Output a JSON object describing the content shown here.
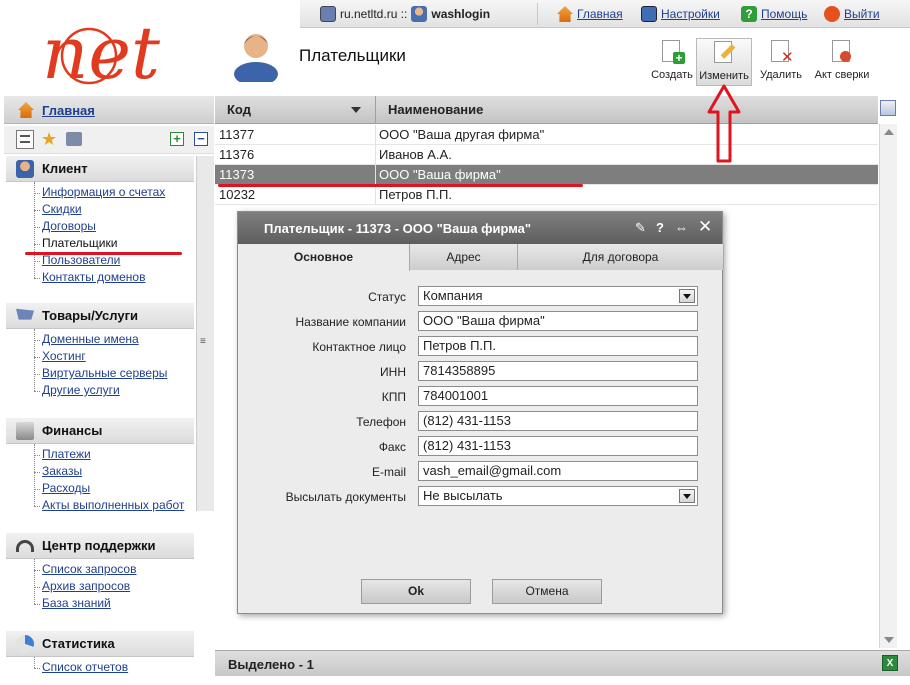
{
  "topbar": {
    "host_user": "ru.netltd.ru ::",
    "username": "washlogin",
    "home": "Главная",
    "settings": "Настройки",
    "help": "Помощь",
    "logout": "Выйти"
  },
  "logo_text": "net",
  "page": {
    "title": "Плательщики"
  },
  "toolbar": {
    "create": "Создать",
    "edit": "Изменить",
    "delete": "Удалить",
    "reconcile": "Акт сверки"
  },
  "sidebar": {
    "home": "Главная",
    "sections": [
      {
        "title": "Клиент",
        "items": [
          "Информация о счетах",
          "Скидки",
          "Договоры",
          "Плательщики",
          "Пользователи",
          "Контакты доменов"
        ]
      },
      {
        "title": "Товары/Услуги",
        "items": [
          "Доменные имена",
          "Хостинг",
          "Виртуальные серверы",
          "Другие услуги"
        ]
      },
      {
        "title": "Финансы",
        "items": [
          "Платежи",
          "Заказы",
          "Расходы",
          "Акты выполненных работ"
        ]
      },
      {
        "title": "Центр поддержки",
        "items": [
          "Список запросов",
          "Архив запросов",
          "База знаний"
        ]
      },
      {
        "title": "Статистика",
        "items": [
          "Список отчетов"
        ]
      }
    ]
  },
  "grid": {
    "col_code": "Код",
    "col_name": "Наименование",
    "rows": [
      {
        "code": "11377",
        "name": "ООО \"Ваша другая фирма\""
      },
      {
        "code": "11376",
        "name": "Иванов А.А."
      },
      {
        "code": "11373",
        "name": "ООО \"Ваша фирма\""
      },
      {
        "code": "10232",
        "name": "Петров П.П."
      }
    ],
    "status": "Выделено - 1"
  },
  "dialog": {
    "title": "Плательщик - 11373 - ООО \"Ваша фирма\"",
    "tabs": [
      "Основное",
      "Адрес",
      "Для договора"
    ],
    "fields": [
      {
        "label": "Статус",
        "value": "Компания",
        "type": "select"
      },
      {
        "label": "Название компании",
        "value": "ООО \"Ваша фирма\"",
        "type": "text"
      },
      {
        "label": "Контактное лицо",
        "value": "Петров П.П.",
        "type": "text"
      },
      {
        "label": "ИНН",
        "value": "7814358895",
        "type": "text"
      },
      {
        "label": "КПП",
        "value": "784001001",
        "type": "text"
      },
      {
        "label": "Телефон",
        "value": "(812) 431-1153",
        "type": "text"
      },
      {
        "label": "Факс",
        "value": "(812) 431-1153",
        "type": "text"
      },
      {
        "label": "E-mail",
        "value": "vash_email@gmail.com",
        "type": "text"
      },
      {
        "label": "Высылать документы",
        "value": "Не высылать",
        "type": "select"
      }
    ],
    "ok": "Ok",
    "cancel": "Отмена"
  },
  "colors": {
    "accent_red": "#e0141e",
    "link": "#1f3f8f",
    "selected_row": "#7e7e7e"
  }
}
